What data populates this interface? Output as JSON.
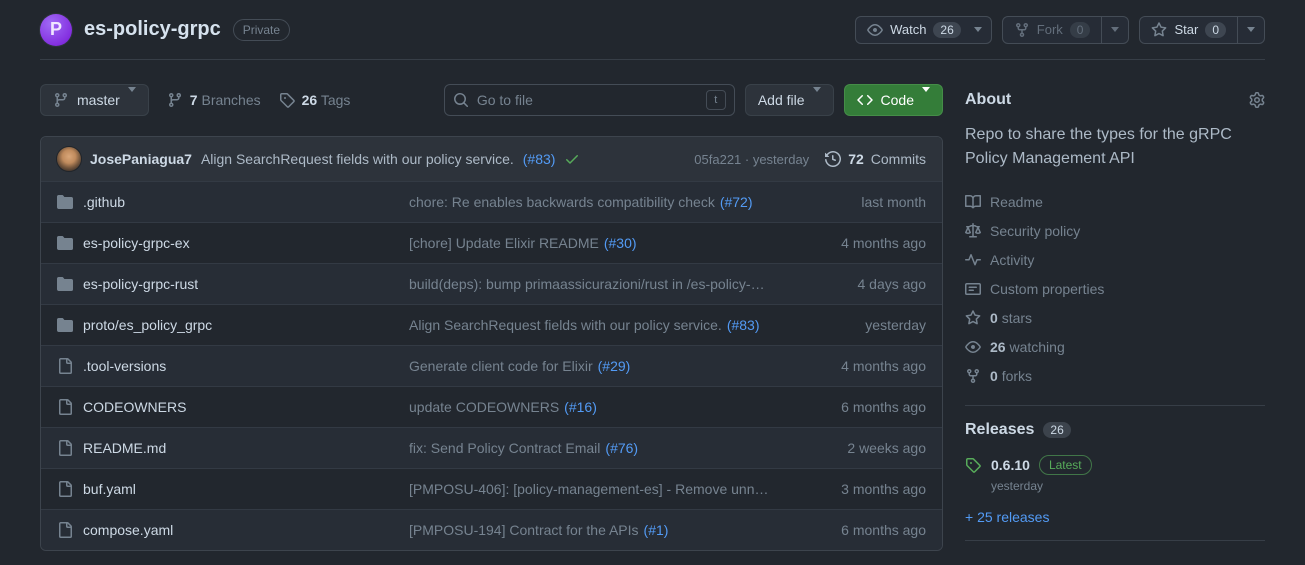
{
  "colors": {
    "accent_green": "#347d39",
    "link_blue": "#539bf5",
    "success_green": "#57ab5a",
    "avatar_purple": "#8430e0"
  },
  "header": {
    "avatar_letter": "P",
    "repo_name": "es-policy-grpc",
    "visibility_badge": "Private",
    "watch": {
      "label": "Watch",
      "count": "26"
    },
    "fork": {
      "label": "Fork",
      "count": "0"
    },
    "star": {
      "label": "Star",
      "count": "0"
    }
  },
  "toolbar": {
    "branch_name": "master",
    "branches_count": "7",
    "branches_label": "Branches",
    "tags_count": "26",
    "tags_label": "Tags",
    "search_placeholder": "Go to file",
    "search_shortcut": "t",
    "add_file_label": "Add file",
    "code_label": "Code"
  },
  "commit_bar": {
    "author": "JosePaniagua7",
    "message": "Align SearchRequest fields with our policy service.",
    "pr_link": "(#83)",
    "sha_time": "05fa221 · yesterday",
    "commits_count": "72",
    "commits_label": "Commits"
  },
  "files": [
    {
      "type": "folder",
      "name": ".github",
      "message": "chore: Re enables backwards compatibility check",
      "link": "(#72)",
      "date": "last month"
    },
    {
      "type": "folder",
      "name": "es-policy-grpc-ex",
      "message": "[chore] Update Elixir README",
      "link": "(#30)",
      "date": "4 months ago"
    },
    {
      "type": "folder",
      "name": "es-policy-grpc-rust",
      "message": "build(deps): bump primaassicurazioni/rust in /es-policy-…",
      "link": "",
      "date": "4 days ago"
    },
    {
      "type": "folder",
      "name": "proto/es_policy_grpc",
      "message": "Align SearchRequest fields with our policy service.",
      "link": "(#83)",
      "date": "yesterday"
    },
    {
      "type": "file",
      "name": ".tool-versions",
      "message": "Generate client code for Elixir",
      "link": "(#29)",
      "date": "4 months ago"
    },
    {
      "type": "file",
      "name": "CODEOWNERS",
      "message": "update CODEOWNERS",
      "link": "(#16)",
      "date": "6 months ago"
    },
    {
      "type": "file",
      "name": "README.md",
      "message": "fix: Send Policy Contract Email",
      "link": "(#76)",
      "date": "2 weeks ago"
    },
    {
      "type": "file",
      "name": "buf.yaml",
      "message": "[PMPOSU-406]: [policy-management-es] - Remove unne…",
      "link": "",
      "date": "3 months ago"
    },
    {
      "type": "file",
      "name": "compose.yaml",
      "message": "[PMPOSU-194] Contract for the APIs",
      "link": "(#1)",
      "date": "6 months ago"
    }
  ],
  "sidebar": {
    "about_title": "About",
    "description": "Repo to share the types for the gRPC Policy Management API",
    "links": [
      {
        "label": "Readme",
        "icon": "book-icon"
      },
      {
        "label": "Security policy",
        "icon": "law-icon"
      },
      {
        "label": "Activity",
        "icon": "pulse-icon"
      },
      {
        "label": "Custom properties",
        "icon": "note-icon"
      }
    ],
    "stats": [
      {
        "count": "0",
        "label": "stars",
        "icon": "star-icon"
      },
      {
        "count": "26",
        "label": "watching",
        "icon": "eye-icon"
      },
      {
        "count": "0",
        "label": "forks",
        "icon": "fork-icon"
      }
    ],
    "releases": {
      "title": "Releases",
      "count": "26",
      "version": "0.6.10",
      "latest_label": "Latest",
      "time": "yesterday",
      "more_link": "+ 25 releases"
    }
  }
}
